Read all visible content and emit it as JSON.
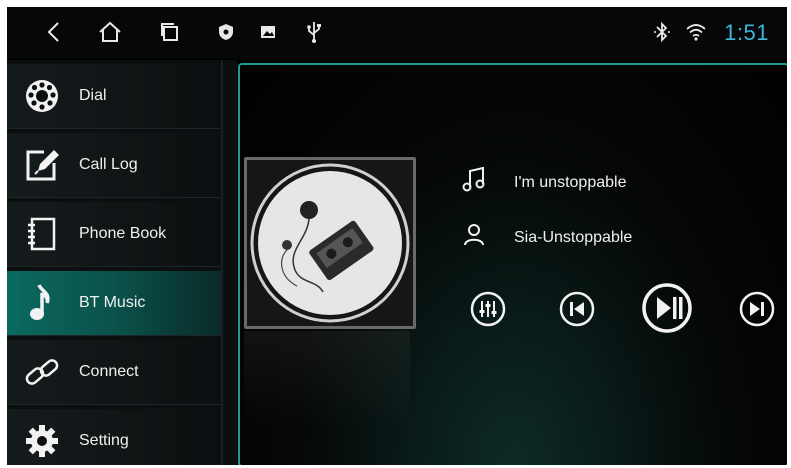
{
  "status_bar": {
    "nav_icons": [
      "back-icon",
      "home-icon",
      "recent-apps-icon"
    ],
    "notification_icons": [
      "shield-icon",
      "image-icon",
      "usb-icon"
    ],
    "system_icons": [
      "bluetooth-icon",
      "wifi-icon"
    ],
    "time": "1:51",
    "time_color": "#3fb6d7"
  },
  "sidebar": {
    "items": [
      {
        "label": "Dial",
        "icon": "dial-icon",
        "active": false
      },
      {
        "label": "Call Log",
        "icon": "call-log-icon",
        "active": false
      },
      {
        "label": "Phone Book",
        "icon": "phone-book-icon",
        "active": false
      },
      {
        "label": "BT Music",
        "icon": "music-note-icon",
        "active": true
      },
      {
        "label": "Connect",
        "icon": "link-icon",
        "active": false
      },
      {
        "label": "Setting",
        "icon": "gear-icon",
        "active": false
      }
    ]
  },
  "player": {
    "song_title": "I'm unstoppable",
    "artist": "Sia-Unstoppable",
    "controls": [
      "equalizer-icon",
      "previous-icon",
      "play-pause-icon",
      "next-icon"
    ],
    "accent_color": "#1f9c92"
  }
}
